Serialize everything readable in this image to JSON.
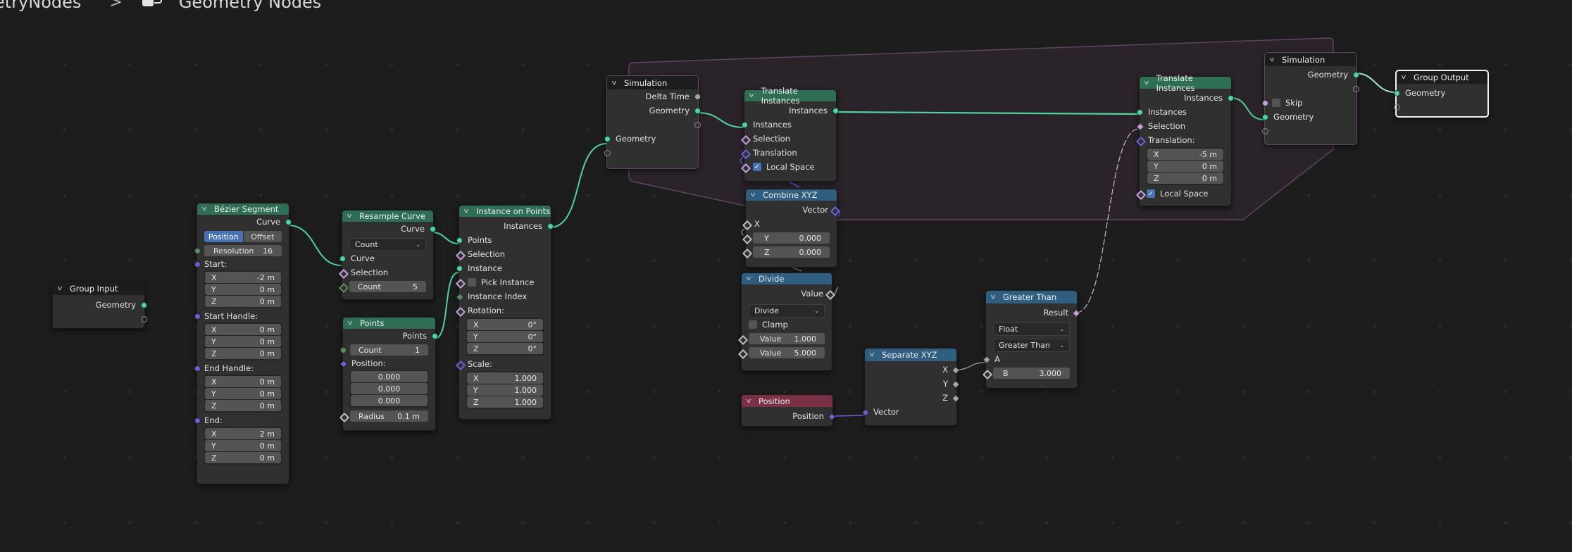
{
  "breadcrumb": {
    "object": "etryNodes",
    "separator": ">",
    "tree_icon": "node-tree-icon",
    "tree": "Geometry Nodes"
  },
  "colors": {
    "geometry": "#4fd3a0",
    "vector": "#6b61d6",
    "bool": "#c7a1df",
    "float": "#a5a5a5",
    "int": "#5e8a5c",
    "frame": "#5c4660",
    "header_geometry": "#2e6e55",
    "header_converter": "#2f5e80",
    "header_input": "#7a3146",
    "accent": "#4772b3"
  },
  "nodes": {
    "group_input": {
      "title": "Group Input",
      "outputs": [
        "Geometry"
      ]
    },
    "bezier": {
      "title": "Bézier Segment",
      "output": "Curve",
      "mode": [
        "Position",
        "Offset"
      ],
      "mode_active": "Position",
      "resolution": {
        "label": "Resolution",
        "value": "16"
      },
      "start": {
        "label": "Start:",
        "x": "-2 m",
        "y": "0 m",
        "z": "0 m"
      },
      "start_handle": {
        "label": "Start Handle:",
        "x": "0 m",
        "y": "0 m",
        "z": "0 m"
      },
      "end_handle": {
        "label": "End Handle:",
        "x": "0 m",
        "y": "0 m",
        "z": "0 m"
      },
      "end": {
        "label": "End:",
        "x": "2 m",
        "y": "0 m",
        "z": "0 m"
      },
      "axis": {
        "x": "X",
        "y": "Y",
        "z": "Z"
      }
    },
    "resample": {
      "title": "Resample Curve",
      "output": "Curve",
      "mode": "Count",
      "inputs": [
        "Curve",
        "Selection"
      ],
      "count": {
        "label": "Count",
        "value": "5"
      }
    },
    "points": {
      "title": "Points",
      "output": "Points",
      "count": {
        "label": "Count",
        "value": "1"
      },
      "position_label": "Position:",
      "position": [
        "0.000",
        "0.000",
        "0.000"
      ],
      "radius": {
        "label": "Radius",
        "value": "0.1 m"
      }
    },
    "instance_on_points": {
      "title": "Instance on Points",
      "output": "Instances",
      "inputs": [
        "Points",
        "Selection",
        "Instance",
        "Pick Instance",
        "Instance Index"
      ],
      "rotation": {
        "label": "Rotation:",
        "x": "0°",
        "y": "0°",
        "z": "0°"
      },
      "scale": {
        "label": "Scale:",
        "x": "1.000",
        "y": "1.000",
        "z": "1.000"
      }
    },
    "sim_input": {
      "title": "Simulation",
      "outputs": [
        "Delta Time",
        "Geometry"
      ],
      "inputs": [
        "Geometry"
      ]
    },
    "translate1": {
      "title": "Translate Instances",
      "output": "Instances",
      "inputs": [
        "Instances",
        "Selection",
        "Translation"
      ],
      "local_space": {
        "label": "Local Space",
        "checked": true
      }
    },
    "combine_xyz": {
      "title": "Combine XYZ",
      "output": "Vector",
      "x_label": "X",
      "y": {
        "label": "Y",
        "value": "0.000"
      },
      "z": {
        "label": "Z",
        "value": "0.000"
      }
    },
    "divide": {
      "title": "Divide",
      "output": "Value",
      "operation": "Divide",
      "clamp": {
        "label": "Clamp",
        "checked": false
      },
      "value1": {
        "label": "Value",
        "value": "1.000"
      },
      "value2": {
        "label": "Value",
        "value": "5.000"
      }
    },
    "position": {
      "title": "Position",
      "output": "Position"
    },
    "separate_xyz": {
      "title": "Separate XYZ",
      "outputs": [
        "X",
        "Y",
        "Z"
      ],
      "input": "Vector"
    },
    "greater_than": {
      "title": "Greater Than",
      "output": "Result",
      "type": "Float",
      "operation": "Greater Than",
      "a_label": "A",
      "b": {
        "label": "B",
        "value": "3.000"
      }
    },
    "translate2": {
      "title": "Translate Instances",
      "output": "Instances",
      "inputs": [
        "Instances",
        "Selection"
      ],
      "translation": {
        "label": "Translation:",
        "x": "-5 m",
        "y": "0 m",
        "z": "0 m"
      },
      "local_space": {
        "label": "Local Space",
        "checked": true
      }
    },
    "sim_output": {
      "title": "Simulation",
      "output": "Geometry",
      "skip": {
        "label": "Skip",
        "checked": false
      },
      "input": "Geometry"
    },
    "group_output": {
      "title": "Group Output",
      "inputs": [
        "Geometry"
      ]
    }
  }
}
